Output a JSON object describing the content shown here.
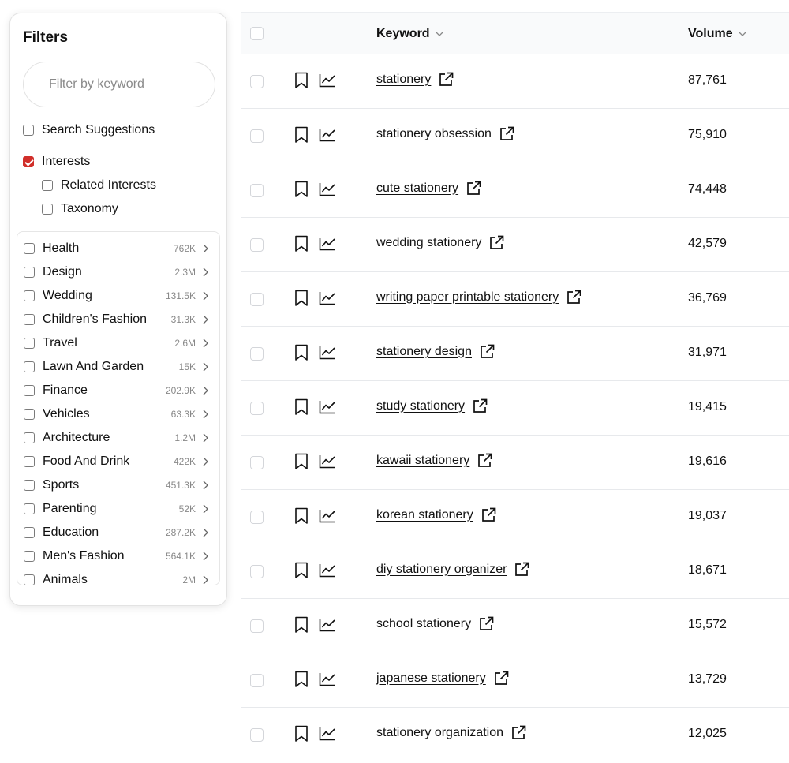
{
  "filters": {
    "title": "Filters",
    "keyword_placeholder": "Filter by keyword",
    "options": [
      {
        "label": "Search Suggestions",
        "checked": false
      },
      {
        "label": "Interests",
        "checked": true
      },
      {
        "label": "Related Interests",
        "checked": false
      },
      {
        "label": "Taxonomy",
        "checked": false
      }
    ],
    "interests": [
      {
        "name": "Health",
        "count": "762K"
      },
      {
        "name": "Design",
        "count": "2.3M"
      },
      {
        "name": "Wedding",
        "count": "131.5K"
      },
      {
        "name": "Children's Fashion",
        "count": "31.3K"
      },
      {
        "name": "Travel",
        "count": "2.6M"
      },
      {
        "name": "Lawn And Garden",
        "count": "15K"
      },
      {
        "name": "Finance",
        "count": "202.9K"
      },
      {
        "name": "Vehicles",
        "count": "63.3K"
      },
      {
        "name": "Architecture",
        "count": "1.2M"
      },
      {
        "name": "Food And Drink",
        "count": "422K"
      },
      {
        "name": "Sports",
        "count": "451.3K"
      },
      {
        "name": "Parenting",
        "count": "52K"
      },
      {
        "name": "Education",
        "count": "287.2K"
      },
      {
        "name": "Men's Fashion",
        "count": "564.1K"
      },
      {
        "name": "Animals",
        "count": "2M"
      }
    ]
  },
  "table": {
    "columns": {
      "keyword": "Keyword",
      "volume": "Volume"
    },
    "rows": [
      {
        "keyword": "stationery",
        "volume": "87,761"
      },
      {
        "keyword": "stationery obsession",
        "volume": "75,910"
      },
      {
        "keyword": "cute stationery",
        "volume": "74,448"
      },
      {
        "keyword": "wedding stationery",
        "volume": "42,579"
      },
      {
        "keyword": "writing paper printable stationery",
        "volume": "36,769"
      },
      {
        "keyword": "stationery design",
        "volume": "31,971"
      },
      {
        "keyword": "study stationery",
        "volume": "19,415"
      },
      {
        "keyword": "kawaii stationery",
        "volume": "19,616"
      },
      {
        "keyword": "korean stationery",
        "volume": "19,037"
      },
      {
        "keyword": "diy stationery organizer",
        "volume": "18,671"
      },
      {
        "keyword": "school stationery",
        "volume": "15,572"
      },
      {
        "keyword": "japanese stationery",
        "volume": "13,729"
      },
      {
        "keyword": "stationery organization",
        "volume": "12,025"
      }
    ]
  },
  "colors": {
    "accent_checkbox": "#d12f2a"
  }
}
